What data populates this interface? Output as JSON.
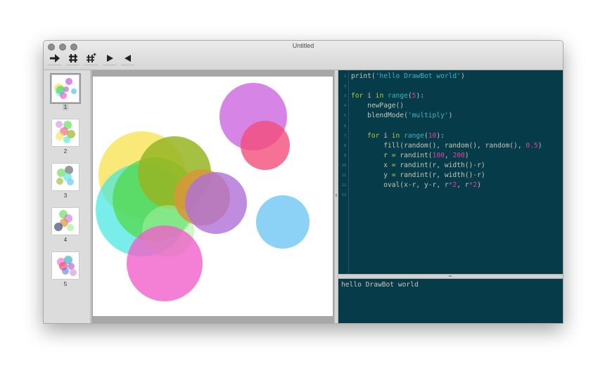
{
  "window": {
    "title": "Untitled"
  },
  "toolbar": {
    "tools": [
      {
        "icon": "arrow-right-icon"
      },
      {
        "icon": "hash-icon"
      },
      {
        "icon": "sparkle-hash-icon"
      },
      {
        "icon": "play-icon"
      },
      {
        "icon": "reverse-play-icon"
      }
    ]
  },
  "pages": [
    {
      "label": "1",
      "selected": true
    },
    {
      "label": "2",
      "selected": false
    },
    {
      "label": "3",
      "selected": false
    },
    {
      "label": "4",
      "selected": false
    },
    {
      "label": "5",
      "selected": false
    }
  ],
  "code": {
    "lines": [
      [
        {
          "t": "print(",
          "c": "fn"
        },
        {
          "t": "'hello DrawBot world'",
          "c": "str"
        },
        {
          "t": ")",
          "c": "fn"
        }
      ],
      [],
      [
        {
          "t": "for ",
          "c": "kw"
        },
        {
          "t": "i ",
          "c": "fn"
        },
        {
          "t": "in ",
          "c": "kw"
        },
        {
          "t": "range",
          "c": "str"
        },
        {
          "t": "(",
          "c": "fn"
        },
        {
          "t": "5",
          "c": "num"
        },
        {
          "t": "):",
          "c": "fn"
        }
      ],
      [
        {
          "t": "    newPage()",
          "c": "fn"
        }
      ],
      [
        {
          "t": "    blendMode(",
          "c": "fn"
        },
        {
          "t": "'multiply'",
          "c": "str"
        },
        {
          "t": ")",
          "c": "fn"
        }
      ],
      [],
      [
        {
          "t": "    for ",
          "c": "kw"
        },
        {
          "t": "i ",
          "c": "fn"
        },
        {
          "t": "in ",
          "c": "kw"
        },
        {
          "t": "range",
          "c": "str"
        },
        {
          "t": "(",
          "c": "fn"
        },
        {
          "t": "10",
          "c": "num"
        },
        {
          "t": "):",
          "c": "fn"
        }
      ],
      [
        {
          "t": "        fill(random(), random(), random(), ",
          "c": "fn"
        },
        {
          "t": "0.5",
          "c": "num"
        },
        {
          "t": ")",
          "c": "fn"
        }
      ],
      [
        {
          "t": "        r ",
          "c": "fn"
        },
        {
          "t": "= ",
          "c": "kw"
        },
        {
          "t": "randint(",
          "c": "fn"
        },
        {
          "t": "100",
          "c": "num"
        },
        {
          "t": ", ",
          "c": "fn"
        },
        {
          "t": "200",
          "c": "num"
        },
        {
          "t": ")",
          "c": "fn"
        }
      ],
      [
        {
          "t": "        x ",
          "c": "fn"
        },
        {
          "t": "= ",
          "c": "kw"
        },
        {
          "t": "randint(r, width()",
          "c": "fn"
        },
        {
          "t": "-",
          "c": "kw"
        },
        {
          "t": "r)",
          "c": "fn"
        }
      ],
      [
        {
          "t": "        y ",
          "c": "fn"
        },
        {
          "t": "= ",
          "c": "kw"
        },
        {
          "t": "randint(r, width()",
          "c": "fn"
        },
        {
          "t": "-",
          "c": "kw"
        },
        {
          "t": "r)",
          "c": "fn"
        }
      ],
      [
        {
          "t": "        oval(x",
          "c": "fn"
        },
        {
          "t": "-",
          "c": "kw"
        },
        {
          "t": "r, y",
          "c": "fn"
        },
        {
          "t": "-",
          "c": "kw"
        },
        {
          "t": "r, r",
          "c": "fn"
        },
        {
          "t": "*2",
          "c": "num"
        },
        {
          "t": ", r",
          "c": "fn"
        },
        {
          "t": "*2",
          "c": "num"
        },
        {
          "t": ")",
          "c": "fn"
        }
      ],
      []
    ],
    "line_numbers": [
      "1",
      "2",
      "3",
      "4",
      "5",
      "6",
      "7",
      "8",
      "9",
      "10",
      "11",
      "12",
      "13"
    ]
  },
  "output": {
    "text": "hello DrawBot world"
  },
  "colors": {
    "editor_bg": "#063b4a",
    "keyword": "#b7c93a",
    "string": "#3fb3c4",
    "number": "#e0409a",
    "plain": "#c7c7b4"
  },
  "circles": [
    {
      "color": "#f7e24b",
      "opacity": 0.75
    },
    {
      "color": "#3fe6e0",
      "opacity": 0.7
    },
    {
      "color": "#53d84a",
      "opacity": 0.75
    },
    {
      "color": "#96b523",
      "opacity": 0.85
    },
    {
      "color": "#a4f29a",
      "opacity": 0.55
    },
    {
      "color": "#f060c9",
      "opacity": 0.8
    },
    {
      "color": "#cf6fe0",
      "opacity": 0.85
    },
    {
      "color": "#f24d7a",
      "opacity": 0.8
    },
    {
      "color": "#d8963a",
      "opacity": 0.85
    },
    {
      "color": "#b06fd8",
      "opacity": 0.8
    },
    {
      "color": "#7ecdf5",
      "opacity": 0.9
    }
  ]
}
